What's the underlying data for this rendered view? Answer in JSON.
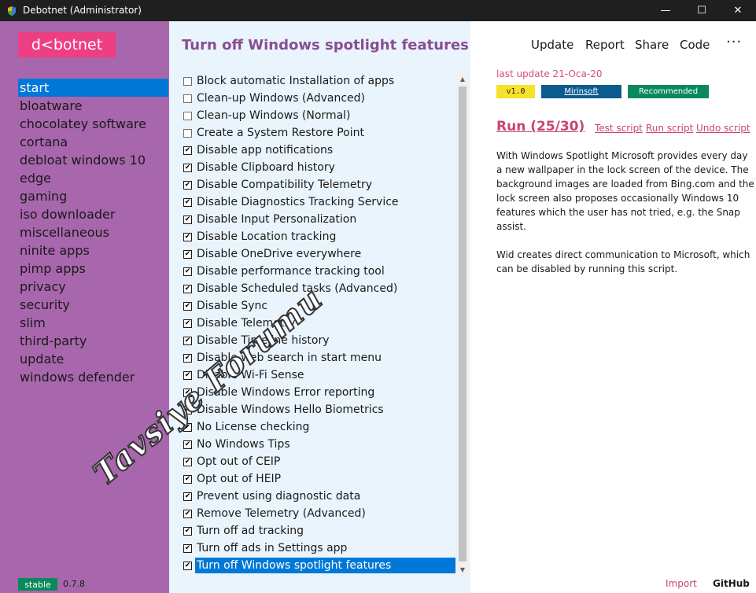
{
  "titlebar": {
    "title": "Debotnet (Administrator)",
    "minimize": "—",
    "maximize": "☐",
    "close": "✕"
  },
  "sidebar": {
    "logo": "d<botnet",
    "items": [
      {
        "label": "start",
        "active": true
      },
      {
        "label": "bloatware"
      },
      {
        "label": "chocolatey software"
      },
      {
        "label": "cortana"
      },
      {
        "label": "debloat windows 10"
      },
      {
        "label": "edge"
      },
      {
        "label": "gaming"
      },
      {
        "label": "iso downloader"
      },
      {
        "label": "miscellaneous"
      },
      {
        "label": "ninite apps"
      },
      {
        "label": "pimp apps"
      },
      {
        "label": "privacy"
      },
      {
        "label": "security"
      },
      {
        "label": "slim"
      },
      {
        "label": "third-party"
      },
      {
        "label": "update"
      },
      {
        "label": "windows defender"
      }
    ],
    "status_badge": "stable",
    "version": "0.7.8"
  },
  "middle": {
    "title": "Turn off Windows spotlight features",
    "items": [
      {
        "label": "Block automatic Installation of apps",
        "checked": false
      },
      {
        "label": "Clean-up Windows (Advanced)",
        "checked": false
      },
      {
        "label": "Clean-up Windows (Normal)",
        "checked": false
      },
      {
        "label": "Create a System Restore Point",
        "checked": false
      },
      {
        "label": "Disable app notifications",
        "checked": true
      },
      {
        "label": "Disable Clipboard history",
        "checked": true
      },
      {
        "label": "Disable Compatibility Telemetry",
        "checked": true
      },
      {
        "label": "Disable Diagnostics Tracking Service",
        "checked": true
      },
      {
        "label": "Disable Input Personalization",
        "checked": true
      },
      {
        "label": "Disable Location tracking",
        "checked": true
      },
      {
        "label": "Disable OneDrive everywhere",
        "checked": true
      },
      {
        "label": "Disable performance tracking tool",
        "checked": true
      },
      {
        "label": "Disable Scheduled tasks (Advanced)",
        "checked": true
      },
      {
        "label": "Disable Sync",
        "checked": true
      },
      {
        "label": "Disable Telemetry",
        "checked": true
      },
      {
        "label": "Disable Timeline history",
        "checked": true
      },
      {
        "label": "Disable web search in start menu",
        "checked": true
      },
      {
        "label": "Disable Wi-Fi Sense",
        "checked": true
      },
      {
        "label": "Disable Windows Error reporting",
        "checked": true
      },
      {
        "label": "Disable Windows Hello Biometrics",
        "checked": true
      },
      {
        "label": "No License checking",
        "checked": true
      },
      {
        "label": "No Windows Tips",
        "checked": true
      },
      {
        "label": "Opt out of CEIP",
        "checked": true
      },
      {
        "label": "Opt out of HEIP",
        "checked": true
      },
      {
        "label": "Prevent using diagnostic data",
        "checked": true
      },
      {
        "label": "Remove Telemetry (Advanced)",
        "checked": true
      },
      {
        "label": "Turn off ad tracking",
        "checked": true
      },
      {
        "label": "Turn off ads in Settings app",
        "checked": true
      },
      {
        "label": "Turn off Windows spotlight features",
        "checked": true,
        "selected": true
      }
    ]
  },
  "right": {
    "menu": {
      "update": "Update",
      "report": "Report",
      "share": "Share",
      "code": "Code",
      "more": "···"
    },
    "last_update": "last update 21-Oca-20",
    "badges": {
      "version": "v1.0",
      "author": "Mirinsoft",
      "recommended": "Recommended"
    },
    "run": "Run (25/30)",
    "links": {
      "test": "Test script",
      "run": "Run script",
      "undo": "Undo script"
    },
    "description": [
      "With Windows Spotlight Microsoft provides every day a new wallpaper in the lock screen of the device. The background images are loaded from Bing.com and the lock screen also proposes occasionally Windows 10 features which the user has not tried, e.g. the Snap assist.",
      "Wid creates direct communication to Microsoft, which can be disabled by running this script."
    ],
    "footer": {
      "import": "Import",
      "github": "GitHub"
    }
  },
  "watermark": "Tavsiye Forumu",
  "colors": {
    "sidebar": "#a866ad",
    "logo": "#ee3e84",
    "accent": "#0078d7",
    "middle_bg": "#eaf4fc",
    "title": "#8a4d92",
    "link": "#c8456f",
    "stable": "#0a8a5c"
  },
  "icons": {
    "app": "shield-icon",
    "checkbox_checked": "checkmark-icon"
  }
}
